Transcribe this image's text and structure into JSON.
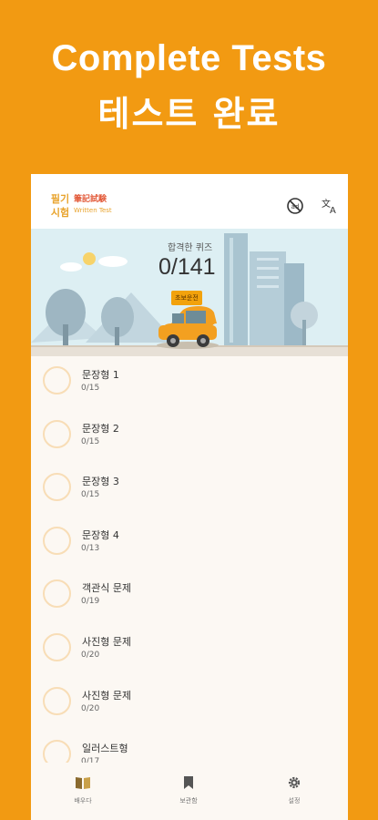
{
  "promo": {
    "title": "Complete Tests",
    "subtitle": "테스트 완료"
  },
  "app": {
    "logo_kor_line1": "필기",
    "logo_kor_line2": "시험",
    "logo_jp": "筆記試験",
    "logo_en": "Written Test",
    "icons": [
      "no-ads-icon",
      "translate-icon"
    ]
  },
  "hero": {
    "label": "합격한 퀴즈",
    "count": "0/141",
    "badge": "초보운전"
  },
  "list": {
    "items": [
      {
        "title": "문장형 1",
        "count": "0/15"
      },
      {
        "title": "문장형 2",
        "count": "0/15"
      },
      {
        "title": "문장형 3",
        "count": "0/15"
      },
      {
        "title": "문장형 4",
        "count": "0/13"
      },
      {
        "title": "객관식 문제",
        "count": "0/19"
      },
      {
        "title": "사진형 문제",
        "count": "0/20"
      },
      {
        "title": "사진형 문제",
        "count": "0/20"
      },
      {
        "title": "일러스트형",
        "count": "0/17"
      }
    ]
  },
  "nav": {
    "learn": "배우다",
    "bookmark": "보관함",
    "settings": "설정"
  },
  "colors": {
    "background": "#F29A12",
    "accent": "#F2A20C",
    "circle_border": "#F8DDB6"
  }
}
